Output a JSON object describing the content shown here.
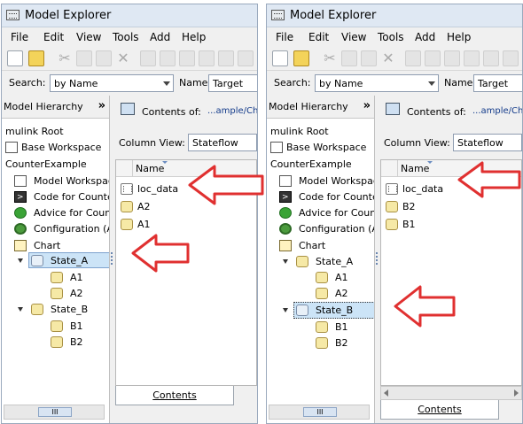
{
  "panels": [
    {
      "title": "Model Explorer",
      "menu": [
        "File",
        "Edit",
        "View",
        "Tools",
        "Add",
        "Help"
      ],
      "search_label": "Search:",
      "search_by": "by Name",
      "name_label": "Name:",
      "name_value": "Target",
      "left_header": "Model Hierarchy",
      "left_chevron": "»",
      "tree": [
        {
          "label": "mulink Root",
          "icon": "none"
        },
        {
          "label": "Base Workspace",
          "icon": "workspace-icon"
        },
        {
          "label": "CounterExample",
          "icon": "none"
        },
        {
          "label": "Model Workspac",
          "icon": "workspace-icon"
        },
        {
          "label": "Code for Counte",
          "icon": "code-icon"
        },
        {
          "label": "Advice for Count",
          "icon": "check-icon"
        },
        {
          "label": "Configuration (A",
          "icon": "gear-icon"
        },
        {
          "label": "Chart",
          "icon": "chart-icon"
        },
        {
          "label": "State_A",
          "icon": "state-icon",
          "selected": true
        },
        {
          "label": "A1",
          "icon": "state-icon"
        },
        {
          "label": "A2",
          "icon": "state-icon"
        },
        {
          "label": "State_B",
          "icon": "state-icon"
        },
        {
          "label": "B1",
          "icon": "state-icon"
        },
        {
          "label": "B2",
          "icon": "state-icon"
        }
      ],
      "scroll_thumb": "III",
      "contents_label": "Contents of:",
      "contents_path": "...ample/Ch",
      "column_view_label": "Column View:",
      "column_view_value": "Stateflow",
      "column_name": "Name",
      "items": [
        {
          "label": "loc_data",
          "icon": "data-icon"
        },
        {
          "label": "A2",
          "icon": "state-icon"
        },
        {
          "label": "A1",
          "icon": "state-icon"
        }
      ],
      "tab_label": "Contents"
    },
    {
      "title": "Model Explorer",
      "menu": [
        "File",
        "Edit",
        "View",
        "Tools",
        "Add",
        "Help"
      ],
      "search_label": "Search:",
      "search_by": "by Name",
      "name_label": "Name:",
      "name_value": "Target",
      "left_header": "Model Hierarchy",
      "left_chevron": "»",
      "tree": [
        {
          "label": "mulink Root",
          "icon": "none"
        },
        {
          "label": "Base Workspace",
          "icon": "workspace-icon"
        },
        {
          "label": "CounterExample",
          "icon": "none"
        },
        {
          "label": "Model Workspac",
          "icon": "workspace-icon"
        },
        {
          "label": "Code for Counte",
          "icon": "code-icon"
        },
        {
          "label": "Advice for Count",
          "icon": "check-icon"
        },
        {
          "label": "Configuration (A",
          "icon": "gear-icon"
        },
        {
          "label": "Chart",
          "icon": "chart-icon"
        },
        {
          "label": "State_A",
          "icon": "state-icon"
        },
        {
          "label": "A1",
          "icon": "state-icon"
        },
        {
          "label": "A2",
          "icon": "state-icon"
        },
        {
          "label": "State_B",
          "icon": "state-icon",
          "selected": true
        },
        {
          "label": "B1",
          "icon": "state-icon"
        },
        {
          "label": "B2",
          "icon": "state-icon"
        }
      ],
      "scroll_thumb": "III",
      "contents_label": "Contents of:",
      "contents_path": "...ample/Ch",
      "column_view_label": "Column View:",
      "column_view_value": "Stateflow",
      "column_name": "Name",
      "items": [
        {
          "label": "loc_data",
          "icon": "data-icon"
        },
        {
          "label": "B2",
          "icon": "state-icon"
        },
        {
          "label": "B1",
          "icon": "state-icon"
        }
      ],
      "tab_label": "Contents"
    }
  ],
  "colors": {
    "annotation_arrow": "#e03030",
    "selection": "#cce4f7"
  }
}
